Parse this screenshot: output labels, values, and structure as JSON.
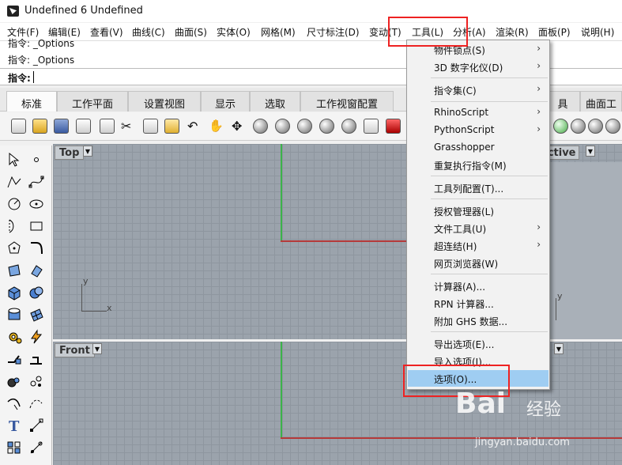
{
  "window": {
    "title": "Undefined 6 Undefined"
  },
  "menubar": {
    "items": [
      {
        "label": "文件(F)"
      },
      {
        "label": "编辑(E)"
      },
      {
        "label": "查看(V)"
      },
      {
        "label": "曲线(C)"
      },
      {
        "label": "曲面(S)"
      },
      {
        "label": "实体(O)"
      },
      {
        "label": "网格(M)"
      },
      {
        "label": "尺寸标注(D)"
      },
      {
        "label": "变动(T)"
      },
      {
        "label": "工具(L)"
      },
      {
        "label": "分析(A)"
      },
      {
        "label": "渲染(R)"
      },
      {
        "label": "面板(P)"
      },
      {
        "label": "说明(H)"
      }
    ]
  },
  "command": {
    "history_1": "指令: _Options",
    "history_2": "指令: _Options",
    "prompt": "指令:"
  },
  "tabs": [
    {
      "label": "标准"
    },
    {
      "label": "工作平面"
    },
    {
      "label": "设置视图"
    },
    {
      "label": "显示"
    },
    {
      "label": "选取"
    },
    {
      "label": "工作视窗配置"
    },
    {
      "label": "具"
    },
    {
      "label": "曲面工"
    }
  ],
  "viewports": {
    "top": {
      "label": "Top",
      "axis_x": "x",
      "axis_y": "y"
    },
    "front": {
      "label": "Front"
    },
    "perspective": {
      "label": "ective",
      "axis_y": "y"
    }
  },
  "tools_menu": {
    "items": [
      {
        "label": "物件锁点(S)",
        "submenu": true
      },
      {
        "label": "3D 数字化仪(D)",
        "submenu": true
      },
      {
        "label": "指令集(C)",
        "submenu": true
      },
      {
        "label": "RhinoScript",
        "submenu": true
      },
      {
        "label": "PythonScript",
        "submenu": true
      },
      {
        "label": "Grasshopper",
        "submenu": false
      },
      {
        "label": "重复执行指令(M)",
        "submenu": false
      },
      {
        "label": "工具列配置(T)...",
        "submenu": false
      },
      {
        "label": "授权管理器(L)",
        "submenu": false
      },
      {
        "label": "文件工具(U)",
        "submenu": true
      },
      {
        "label": "超连结(H)",
        "submenu": true
      },
      {
        "label": "网页浏览器(W)",
        "submenu": false
      },
      {
        "label": "计算器(A)...",
        "submenu": false
      },
      {
        "label": "RPN 计算器...",
        "submenu": false
      },
      {
        "label": "附加 GHS 数据...",
        "submenu": false
      },
      {
        "label": "导出选项(E)...",
        "submenu": false
      },
      {
        "label": "导入选项(I)...",
        "submenu": false
      },
      {
        "label": "选项(O)...",
        "submenu": false
      }
    ],
    "arrow": "›"
  },
  "watermark": {
    "main": "Bai",
    "sub": "经验",
    "url": "jingyan.baidu.com"
  },
  "colors": {
    "highlight": "#9fcdf2",
    "annotation": "#e22222",
    "viewport": "#9ba3ac"
  }
}
